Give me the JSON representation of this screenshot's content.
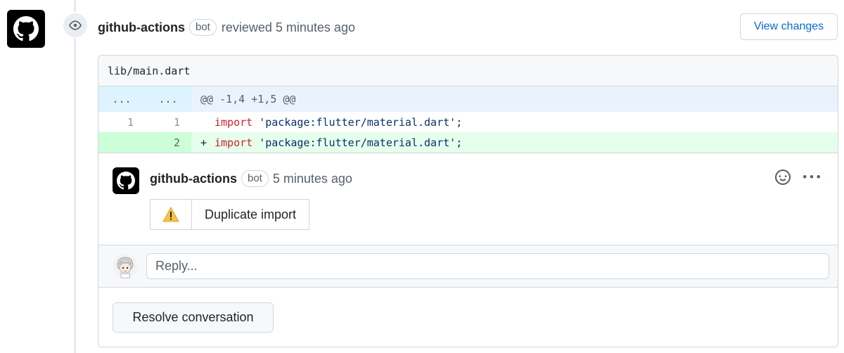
{
  "review": {
    "author": "github-actions",
    "badge": "bot",
    "action_text": "reviewed 5 minutes ago",
    "view_changes_label": "View changes"
  },
  "file": {
    "path": "lib/main.dart",
    "hunk": {
      "old_marker": "...",
      "new_marker": "...",
      "header": "@@ -1,4 +1,5 @@"
    },
    "lines": [
      {
        "old": "1",
        "new": "1",
        "marker": " ",
        "keyword": "import",
        "string": "'package:flutter/material.dart'",
        "punct": ";",
        "type": "context"
      },
      {
        "old": "",
        "new": "2",
        "marker": "+",
        "keyword": "import",
        "string": "'package:flutter/material.dart'",
        "punct": ";",
        "type": "added"
      }
    ]
  },
  "comment": {
    "author": "github-actions",
    "badge": "bot",
    "time": "5 minutes ago",
    "annotation": "Duplicate import",
    "icons": {
      "reaction": "smiley-icon",
      "more": "kebab-horizontal-icon",
      "warning": "warning-icon"
    }
  },
  "reply": {
    "placeholder": "Reply..."
  },
  "resolve": {
    "label": "Resolve conversation"
  },
  "colors": {
    "link": "#0969da",
    "added_bg": "#e6ffec",
    "added_num_bg": "#ccffd8",
    "hunk_bg": "#ddf4ff",
    "keyword": "#cf222e",
    "string": "#0a3069",
    "warning": "#d4a72c"
  }
}
